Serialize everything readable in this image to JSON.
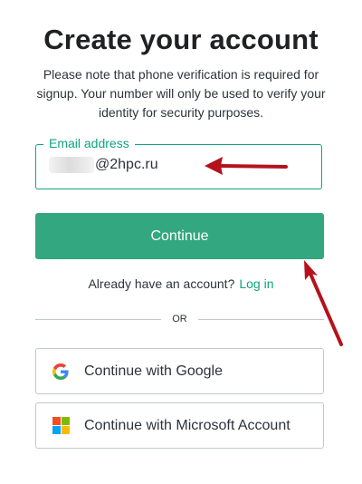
{
  "page": {
    "title": "Create your account",
    "subtitle": "Please note that phone verification is required for signup. Your number will only be used to verify your identity for security purposes."
  },
  "email": {
    "label": "Email address",
    "value_visible": "@2hpc.ru"
  },
  "continue_label": "Continue",
  "login": {
    "prompt": "Already have an account?",
    "link": "Log in"
  },
  "divider_text": "OR",
  "social": {
    "google_label": "Continue with Google",
    "google_icon": "google-icon",
    "microsoft_label": "Continue with Microsoft Account",
    "microsoft_icon": "microsoft-icon"
  },
  "colors": {
    "accent": "#10a37f",
    "button": "#33a77f",
    "annotation_arrow": "#b5121b",
    "ms_red": "#f25022",
    "ms_green": "#7fba00",
    "ms_blue": "#00a4ef",
    "ms_yellow": "#ffb900"
  }
}
